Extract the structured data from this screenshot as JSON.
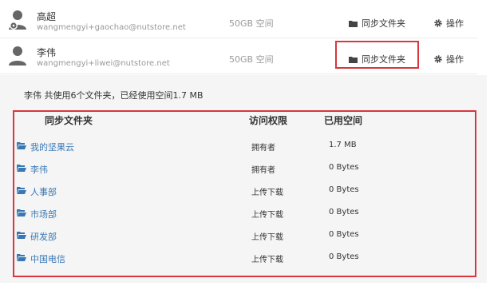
{
  "users": [
    {
      "name": "高超",
      "email": "wangmengyi+gaochao@nutstore.net",
      "space": "50GB 空间",
      "sync_label": "同步文件夹",
      "op_label": "操作",
      "avatar_icon": "user-settings-icon"
    },
    {
      "name": "李伟",
      "email": "wangmengyi+liwei@nutstore.net",
      "space": "50GB 空间",
      "sync_label": "同步文件夹",
      "op_label": "操作",
      "avatar_icon": "user-icon"
    }
  ],
  "detail": {
    "summary": "李伟 共使用6个文件夹，已经使用空间1.7 MB",
    "headers": {
      "folder": "同步文件夹",
      "perm": "访问权限",
      "used": "已用空间"
    },
    "rows": [
      {
        "name": "我的坚果云",
        "perm": "拥有者",
        "used": "1.7 MB"
      },
      {
        "name": "李伟",
        "perm": "拥有者",
        "used": "0 Bytes"
      },
      {
        "name": "人事部",
        "perm": "上传下载",
        "used": "0 Bytes"
      },
      {
        "name": "市场部",
        "perm": "上传下载",
        "used": "0 Bytes"
      },
      {
        "name": "研发部",
        "perm": "上传下载",
        "used": "0 Bytes"
      },
      {
        "name": "中国电信",
        "perm": "上传下载",
        "used": "0 Bytes"
      }
    ]
  },
  "colors": {
    "highlight": "#d9363e",
    "link": "#3a78b5",
    "muted": "#999999"
  }
}
